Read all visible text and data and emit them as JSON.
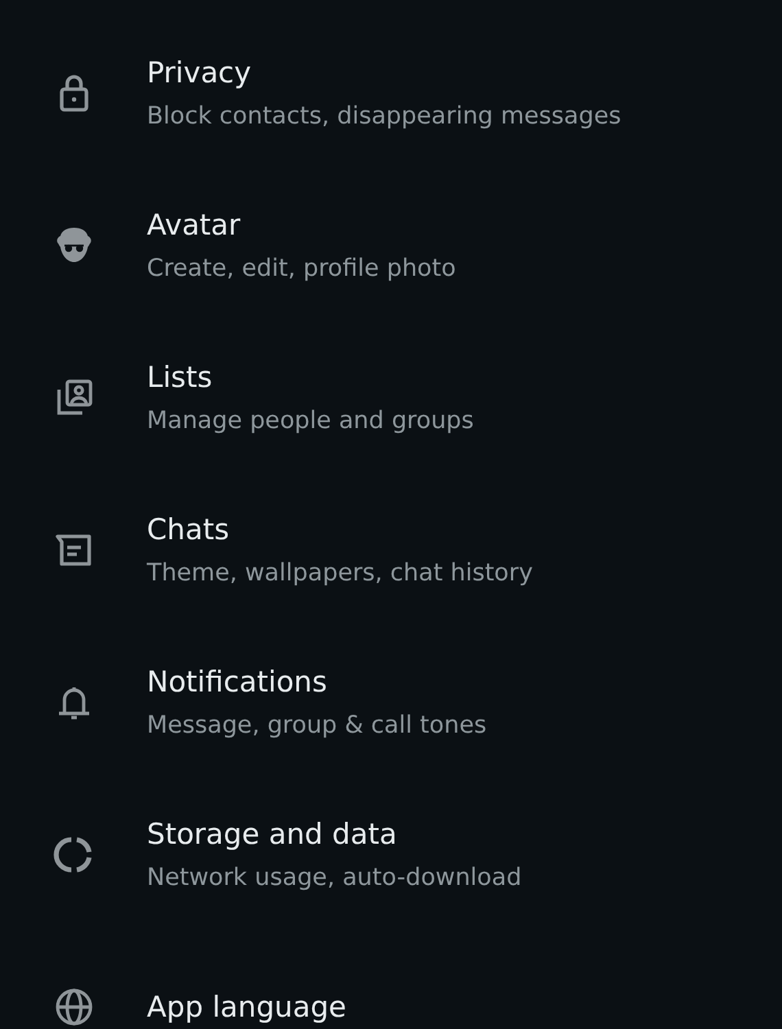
{
  "settings": [
    {
      "title": "Privacy",
      "subtitle": "Block contacts, disappearing messages"
    },
    {
      "title": "Avatar",
      "subtitle": "Create, edit, profile photo"
    },
    {
      "title": "Lists",
      "subtitle": "Manage people and groups"
    },
    {
      "title": "Chats",
      "subtitle": "Theme, wallpapers, chat history"
    },
    {
      "title": "Notifications",
      "subtitle": "Message, group & call tones"
    },
    {
      "title": "Storage and data",
      "subtitle": "Network usage, auto-download"
    },
    {
      "title": "App language"
    }
  ]
}
